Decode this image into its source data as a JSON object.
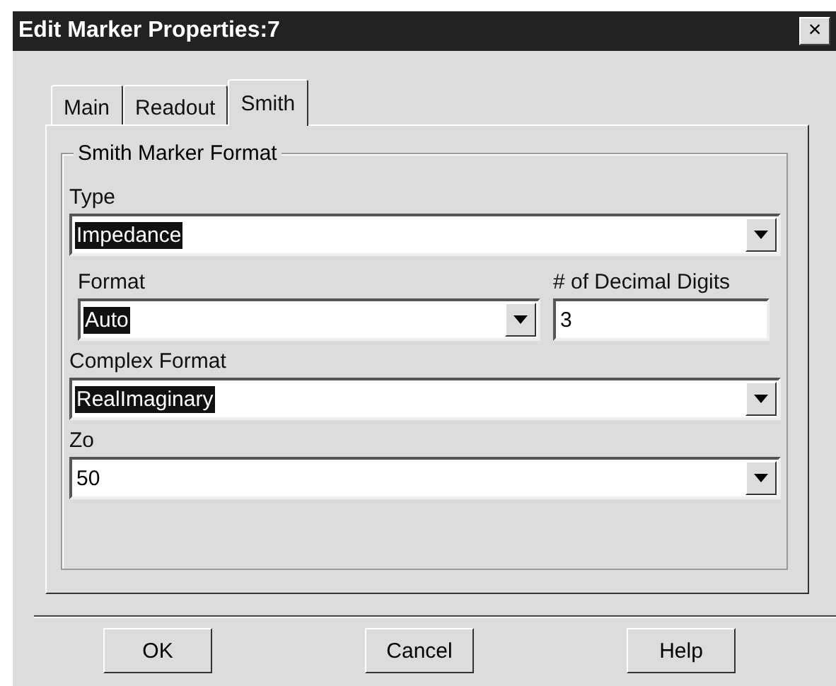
{
  "window": {
    "title": "Edit Marker Properties:7",
    "close": "×"
  },
  "tabs": [
    {
      "label": "Main",
      "selected": false
    },
    {
      "label": "Readout",
      "selected": false
    },
    {
      "label": "Smith",
      "selected": true
    }
  ],
  "group": {
    "title": "Smith Marker Format"
  },
  "fields": [
    {
      "kind": "combo",
      "label": "Type",
      "value": "Impedance",
      "highlighted": true
    },
    {
      "kind": "row",
      "items": [
        {
          "kind": "combo",
          "label": "Format",
          "value": "Auto",
          "highlighted": true
        },
        {
          "kind": "text",
          "label": "# of Decimal Digits",
          "value": "3",
          "highlighted": false
        }
      ]
    },
    {
      "kind": "combo",
      "label": "Complex Format",
      "value": "RealImaginary",
      "highlighted": true
    },
    {
      "kind": "combo",
      "label": "Zo",
      "value": "50",
      "highlighted": false
    }
  ],
  "buttons": [
    "OK",
    "Cancel",
    "Help"
  ]
}
